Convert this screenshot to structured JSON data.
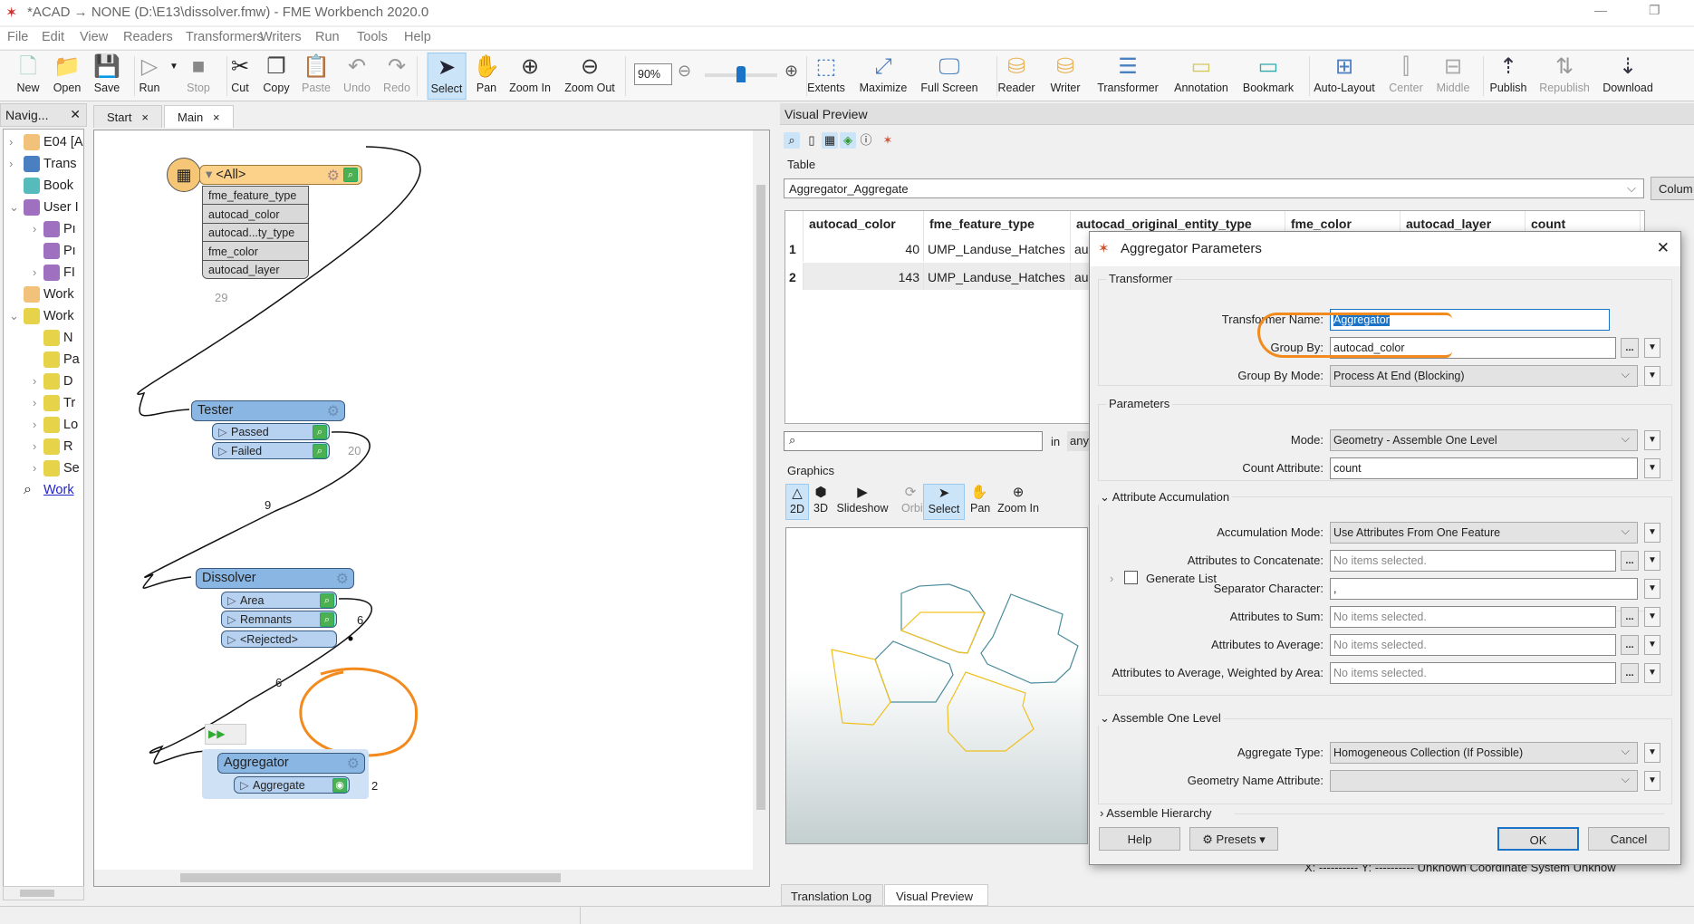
{
  "window": {
    "title": "*ACAD → NONE (D:\\E13\\dissolver.fmw) - FME Workbench 2020.0",
    "minimize": "—",
    "restore": "❐"
  },
  "menu": [
    "File",
    "Edit",
    "View",
    "Readers",
    "Transformers",
    "Writers",
    "Run",
    "Tools",
    "Help"
  ],
  "toolbar": {
    "buttons": [
      {
        "label": "New",
        "icon": "new-file-icon",
        "glyph": "🗋"
      },
      {
        "label": "Open",
        "icon": "folder-icon",
        "glyph": "📁"
      },
      {
        "label": "Save",
        "icon": "save-icon",
        "glyph": "💾"
      },
      {
        "label": "Run",
        "icon": "run-icon",
        "glyph": "▷"
      },
      {
        "label": "Stop",
        "icon": "stop-icon",
        "glyph": "■"
      },
      {
        "label": "Cut",
        "icon": "scissors-icon",
        "glyph": "✂"
      },
      {
        "label": "Copy",
        "icon": "copy-icon",
        "glyph": "❐"
      },
      {
        "label": "Paste",
        "icon": "paste-icon",
        "glyph": "📋"
      },
      {
        "label": "Undo",
        "icon": "undo-icon",
        "glyph": "↶"
      },
      {
        "label": "Redo",
        "icon": "redo-icon",
        "glyph": "↷"
      },
      {
        "label": "Select",
        "icon": "cursor-icon",
        "glyph": "➤"
      },
      {
        "label": "Pan",
        "icon": "hand-icon",
        "glyph": "✋"
      },
      {
        "label": "Zoom In",
        "icon": "zoom-in-icon",
        "glyph": "⊕"
      },
      {
        "label": "Zoom Out",
        "icon": "zoom-out-icon",
        "glyph": "⊖"
      },
      {
        "label": "Extents",
        "icon": "extents-icon",
        "glyph": "⬚"
      },
      {
        "label": "Maximize",
        "icon": "maximize-icon",
        "glyph": "⤢"
      },
      {
        "label": "Full Screen",
        "icon": "fullscreen-icon",
        "glyph": "🖵"
      },
      {
        "label": "Reader",
        "icon": "add-reader-icon",
        "glyph": "⛁"
      },
      {
        "label": "Writer",
        "icon": "add-writer-icon",
        "glyph": "⛁"
      },
      {
        "label": "Transformer",
        "icon": "add-transformer-icon",
        "glyph": "☰"
      },
      {
        "label": "Annotation",
        "icon": "annotation-icon",
        "glyph": "▭"
      },
      {
        "label": "Bookmark",
        "icon": "bookmark-icon",
        "glyph": "▭"
      },
      {
        "label": "Auto-Layout",
        "icon": "auto-layout-icon",
        "glyph": "⊞"
      },
      {
        "label": "Center",
        "icon": "center-icon",
        "glyph": "⫿"
      },
      {
        "label": "Middle",
        "icon": "middle-icon",
        "glyph": "⊟"
      },
      {
        "label": "Publish",
        "icon": "publish-icon",
        "glyph": "⇡"
      },
      {
        "label": "Republish",
        "icon": "republish-icon",
        "glyph": "⇅"
      },
      {
        "label": "Download",
        "icon": "download-icon",
        "glyph": "⇣"
      }
    ],
    "zoom_value": "90%",
    "zoom_slider_level": 0.5
  },
  "navigator": {
    "title": "Navig...",
    "items": [
      {
        "label": "E04 [A",
        "chev": "›",
        "color": "#f2c27a"
      },
      {
        "label": "Trans",
        "chev": "›",
        "color": "#4a7fc1"
      },
      {
        "label": "Book",
        "chev": "",
        "color": "#5bb"
      },
      {
        "label": "User I",
        "chev": "⌄",
        "color": "#a070c0"
      },
      {
        "label": "Pı",
        "chev": "›",
        "color": "#a070c0"
      },
      {
        "label": "Pı",
        "chev": "",
        "color": "#a070c0"
      },
      {
        "label": "FI",
        "chev": "›",
        "color": "#a070c0"
      },
      {
        "label": "Work",
        "chev": "",
        "color": "#f2c27a"
      },
      {
        "label": "Work",
        "chev": "⌄",
        "color": "#e6d34a"
      },
      {
        "label": "N",
        "chev": "",
        "color": "#e6d34a"
      },
      {
        "label": "Pa",
        "chev": "",
        "color": "#e6d34a"
      },
      {
        "label": "D",
        "chev": "›",
        "color": "#e6d34a"
      },
      {
        "label": "Tr",
        "chev": "›",
        "color": "#e6d34a"
      },
      {
        "label": "Lo",
        "chev": "›",
        "color": "#e6d34a"
      },
      {
        "label": "R",
        "chev": "›",
        "color": "#e6d34a"
      },
      {
        "label": "Se",
        "chev": "›",
        "color": "#e6d34a"
      },
      {
        "label": "Work",
        "chev": "",
        "color": "none"
      }
    ]
  },
  "tabs": [
    {
      "label": "Start",
      "close": "×"
    },
    {
      "label": "Main",
      "close": "×"
    }
  ],
  "canvas": {
    "reader": {
      "label": "<All>",
      "attributes": [
        "fme_feature_type",
        "autocad_color",
        "autocad...ty_type",
        "fme_color",
        "autocad_layer"
      ]
    },
    "tester": {
      "label": "Tester",
      "ports": [
        "Passed",
        "Failed"
      ]
    },
    "dissolver": {
      "label": "Dissolver",
      "ports": [
        "Area",
        "Remnants",
        "<Rejected>"
      ]
    },
    "aggregator": {
      "label": "Aggregator",
      "ports": [
        "Aggregate"
      ]
    },
    "counts": [
      "29",
      "20",
      "9",
      "6",
      "6",
      "2"
    ],
    "annotation_color": "#f28a1e"
  },
  "preview": {
    "title": "Visual Preview",
    "table_label": "Table",
    "table_select": "Aggregator_Aggregate",
    "columns_button": "Colum",
    "columns": [
      "autocad_color",
      "fme_feature_type",
      "autocad_original_entity_type",
      "fme_color",
      "autocad_layer",
      "count"
    ],
    "rows": [
      {
        "n": "1",
        "autocad_color": "40",
        "fme_feature_type": "UMP_Landuse_Hatches",
        "entity": "au"
      },
      {
        "n": "2",
        "autocad_color": "143",
        "fme_feature_type": "UMP_Landuse_Hatches",
        "entity": "au"
      }
    ],
    "search_placeholder": "",
    "search_in": "in",
    "search_scope": "any",
    "graphics_label": "Graphics",
    "graphics_tools": [
      {
        "label": "2D",
        "glyph": "△"
      },
      {
        "label": "3D",
        "glyph": "⬢"
      },
      {
        "label": "Slideshow",
        "glyph": "▶"
      },
      {
        "label": "Orbit",
        "glyph": "⟳"
      },
      {
        "label": "Select",
        "glyph": "➤"
      },
      {
        "label": "Pan",
        "glyph": "✋"
      },
      {
        "label": "Zoom In",
        "glyph": "⊕"
      }
    ],
    "polygon_colors": {
      "teal": "#4a8c9a",
      "yellow": "#f0c020"
    },
    "bottom_tabs": [
      "Translation Log",
      "Visual Preview"
    ],
    "status": "X:  ----------  Y:  ----------  Unknown Coordinate System  Unknow"
  },
  "dialog": {
    "title": "Aggregator Parameters",
    "close": "✕",
    "groups": {
      "transformer": "Transformer",
      "parameters": "Parameters",
      "accumulation": "Attribute Accumulation",
      "assemble_one": "Assemble One Level",
      "assemble_hier": "Assemble Hierarchy"
    },
    "fields": {
      "transformer_name": {
        "label": "Transformer Name:",
        "value": "Aggregator"
      },
      "group_by": {
        "label": "Group By:",
        "value": "autocad_color"
      },
      "group_by_mode": {
        "label": "Group By Mode:",
        "value": "Process At End (Blocking)"
      },
      "mode": {
        "label": "Mode:",
        "value": "Geometry - Assemble One Level"
      },
      "count_attr": {
        "label": "Count Attribute:",
        "value": "count"
      },
      "accum_mode": {
        "label": "Accumulation Mode:",
        "value": "Use Attributes From One Feature"
      },
      "concat": {
        "label": "Attributes to Concatenate:",
        "value": "No items selected."
      },
      "sep": {
        "label": "Separator Character:",
        "value": ","
      },
      "sum": {
        "label": "Attributes to Sum:",
        "value": "No items selected."
      },
      "avg": {
        "label": "Attributes to Average:",
        "value": "No items selected."
      },
      "wavg": {
        "label": "Attributes to Average, Weighted by Area:",
        "value": "No items selected."
      },
      "gen_list": {
        "label": "Generate List",
        "checked": false
      },
      "agg_type": {
        "label": "Aggregate Type:",
        "value": "Homogeneous Collection (If Possible)"
      },
      "geom_name": {
        "label": "Geometry Name Attribute:",
        "value": ""
      }
    },
    "buttons": {
      "help": "Help",
      "presets": "Presets",
      "ok": "OK",
      "cancel": "Cancel"
    }
  }
}
